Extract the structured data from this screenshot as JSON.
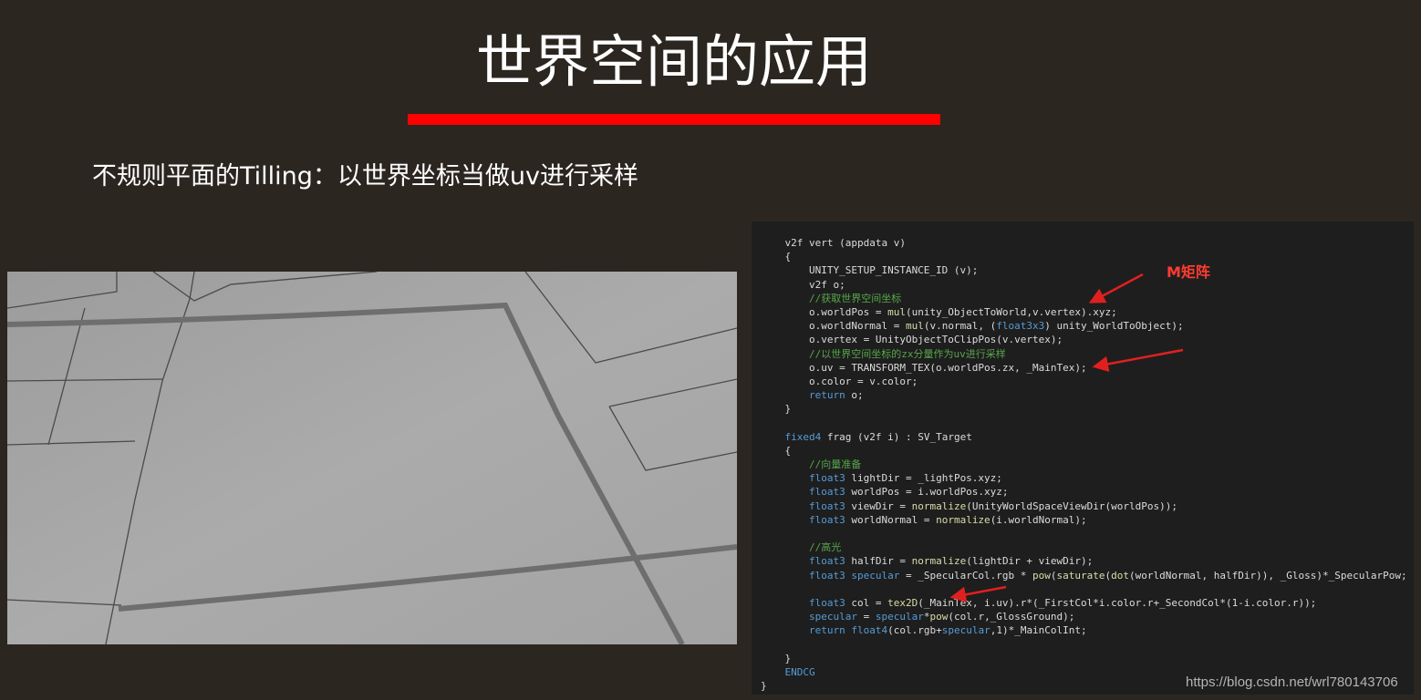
{
  "slide": {
    "title": "世界空间的应用",
    "subtitle": "不规则平面的Tilling：以世界坐标当做uv进行采样",
    "accent_color": "#ff0000",
    "background_color": "#2b2620"
  },
  "scene_image": {
    "background_color": "#a6a6a6"
  },
  "code": {
    "lines": [
      [
        {
          "t": "    v2f vert (appdata v)"
        }
      ],
      [
        {
          "t": "    {"
        }
      ],
      [
        {
          "t": "        UNITY_SETUP_INSTANCE_ID (v);"
        }
      ],
      [
        {
          "t": "        v2f o;"
        }
      ],
      [
        {
          "t": "        //获取世界空间坐标",
          "c": "cm"
        }
      ],
      [
        {
          "t": "        o.worldPos = "
        },
        {
          "t": "mul",
          "c": "fn"
        },
        {
          "t": "(unity_ObjectToWorld,v.vertex).xyz;"
        }
      ],
      [
        {
          "t": "        o.worldNormal = "
        },
        {
          "t": "mul",
          "c": "fn"
        },
        {
          "t": "(v.normal, ("
        },
        {
          "t": "float3x3",
          "c": "kw"
        },
        {
          "t": ") unity_WorldToObject);"
        }
      ],
      [
        {
          "t": "        o.vertex = UnityObjectToClipPos(v.vertex);"
        }
      ],
      [
        {
          "t": "        //以世界空间坐标的zx分量作为uv进行采样",
          "c": "cm"
        }
      ],
      [
        {
          "t": "        o.uv = TRANSFORM_TEX(o.worldPos.zx, _MainTex);"
        }
      ],
      [
        {
          "t": "        o.color = v.color;"
        }
      ],
      [
        {
          "t": "        "
        },
        {
          "t": "return",
          "c": "kw"
        },
        {
          "t": " o;"
        }
      ],
      [
        {
          "t": "    }"
        }
      ],
      [
        {
          "t": ""
        }
      ],
      [
        {
          "t": "    "
        },
        {
          "t": "fixed4",
          "c": "kw"
        },
        {
          "t": " frag (v2f i) : SV_Target"
        }
      ],
      [
        {
          "t": "    {"
        }
      ],
      [
        {
          "t": "        //向量准备",
          "c": "cm"
        }
      ],
      [
        {
          "t": "        "
        },
        {
          "t": "float3",
          "c": "kw"
        },
        {
          "t": " lightDir = _lightPos.xyz;"
        }
      ],
      [
        {
          "t": "        "
        },
        {
          "t": "float3",
          "c": "kw"
        },
        {
          "t": " worldPos = i.worldPos.xyz;"
        }
      ],
      [
        {
          "t": "        "
        },
        {
          "t": "float3",
          "c": "kw"
        },
        {
          "t": " viewDir = "
        },
        {
          "t": "normalize",
          "c": "fn"
        },
        {
          "t": "(UnityWorldSpaceViewDir(worldPos));"
        }
      ],
      [
        {
          "t": "        "
        },
        {
          "t": "float3",
          "c": "kw"
        },
        {
          "t": " worldNormal = "
        },
        {
          "t": "normalize",
          "c": "fn"
        },
        {
          "t": "(i.worldNormal);"
        }
      ],
      [
        {
          "t": ""
        }
      ],
      [
        {
          "t": "        //高光",
          "c": "cm"
        }
      ],
      [
        {
          "t": "        "
        },
        {
          "t": "float3",
          "c": "kw"
        },
        {
          "t": " halfDir = "
        },
        {
          "t": "normalize",
          "c": "fn"
        },
        {
          "t": "(lightDir + viewDir);"
        }
      ],
      [
        {
          "t": "        "
        },
        {
          "t": "float3",
          "c": "kw"
        },
        {
          "t": " "
        },
        {
          "t": "specular",
          "c": "kw"
        },
        {
          "t": " = _SpecularCol.rgb * "
        },
        {
          "t": "pow",
          "c": "fn"
        },
        {
          "t": "("
        },
        {
          "t": "saturate",
          "c": "fn"
        },
        {
          "t": "("
        },
        {
          "t": "dot",
          "c": "fn"
        },
        {
          "t": "(worldNormal, halfDir)), _Gloss)*_SpecularPow;"
        }
      ],
      [
        {
          "t": ""
        }
      ],
      [
        {
          "t": "        "
        },
        {
          "t": "float3",
          "c": "kw"
        },
        {
          "t": " col = "
        },
        {
          "t": "tex2D",
          "c": "fn"
        },
        {
          "t": "(_MainTex, i.uv).r*(_FirstCol*i.color.r+_SecondCol*(1-i.color.r));"
        }
      ],
      [
        {
          "t": "        "
        },
        {
          "t": "specular",
          "c": "kw"
        },
        {
          "t": " = "
        },
        {
          "t": "specular",
          "c": "kw"
        },
        {
          "t": "*"
        },
        {
          "t": "pow",
          "c": "fn"
        },
        {
          "t": "(col.r,_GlossGround);"
        }
      ],
      [
        {
          "t": "        "
        },
        {
          "t": "return",
          "c": "kw"
        },
        {
          "t": " "
        },
        {
          "t": "float4",
          "c": "kw"
        },
        {
          "t": "(col.rgb+"
        },
        {
          "t": "specular",
          "c": "kw"
        },
        {
          "t": ",1)*_MainColInt;"
        }
      ],
      [
        {
          "t": ""
        }
      ],
      [
        {
          "t": "    }"
        }
      ],
      [
        {
          "t": "    "
        },
        {
          "t": "ENDCG",
          "c": "kw"
        }
      ],
      [
        {
          "t": "}"
        }
      ]
    ],
    "colors": {
      "keyword": "#569cd6",
      "function": "#dcdcaa",
      "comment": "#57a64a",
      "text": "#dcdcdc",
      "background": "#1e1e1e"
    }
  },
  "annotation": {
    "label": "M矩阵",
    "color": "#ff3b30"
  },
  "watermark": "https://blog.csdn.net/wrl780143706"
}
